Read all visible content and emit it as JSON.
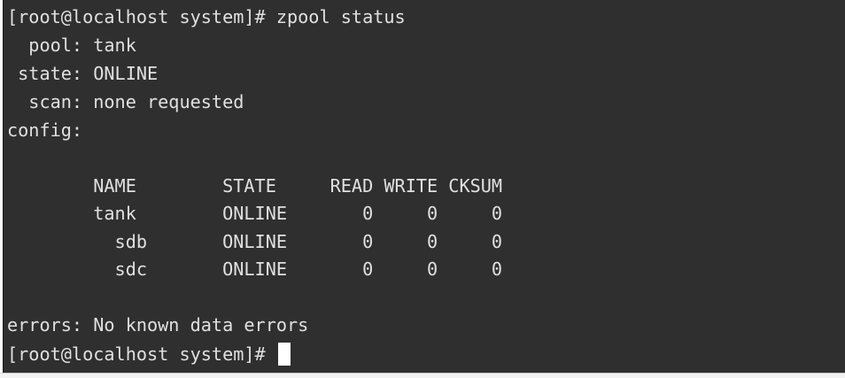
{
  "terminal": {
    "lines": [
      "[root@localhost system]# zpool status",
      "  pool: tank",
      " state: ONLINE",
      "  scan: none requested",
      "config:",
      "",
      "        NAME        STATE     READ WRITE CKSUM",
      "        tank        ONLINE       0     0     0",
      "          sdb       ONLINE       0     0     0",
      "          sdc       ONLINE       0     0     0",
      "",
      "errors: No known data errors"
    ],
    "prompt": "[root@localhost system]# "
  }
}
